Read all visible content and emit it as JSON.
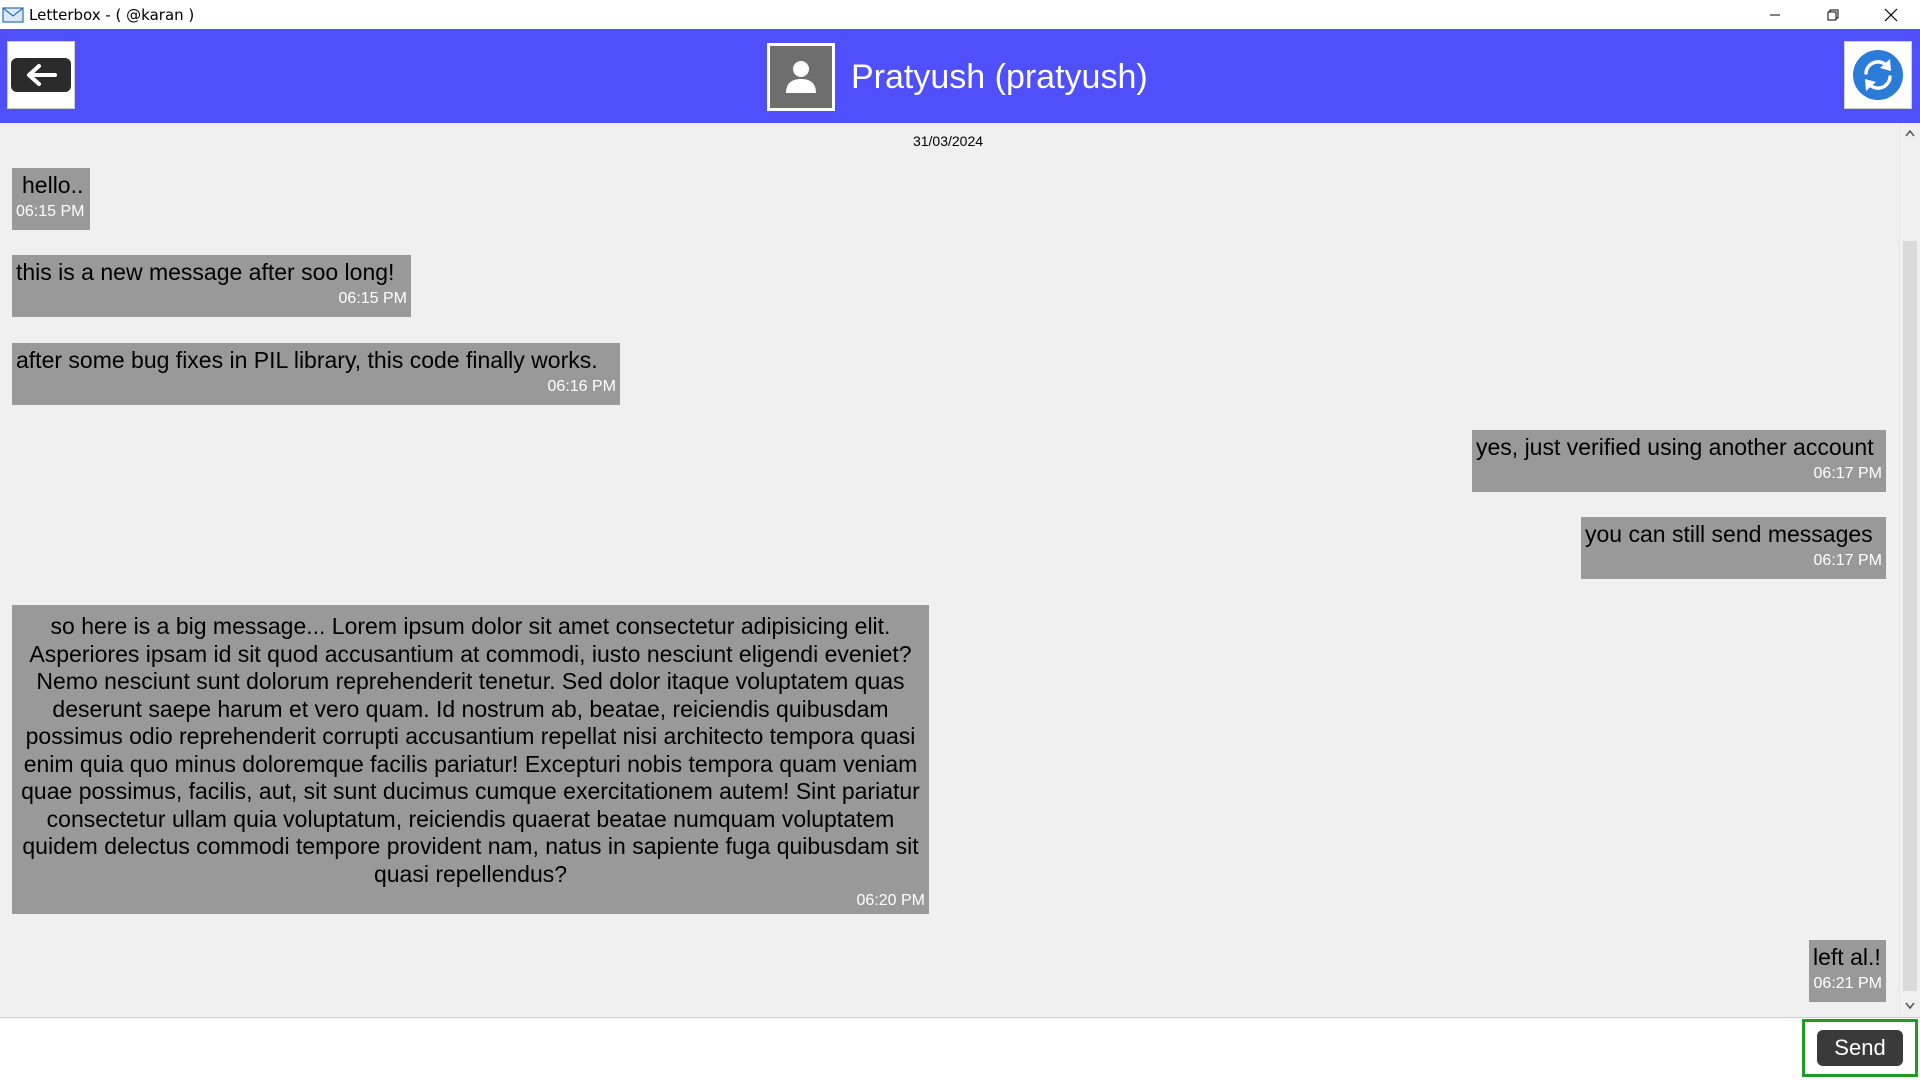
{
  "window": {
    "title": "Letterbox - ( @karan )"
  },
  "header": {
    "contact_name": "Pratyush (pratyush)",
    "accent_color": "#4f4ffc"
  },
  "chat": {
    "date": "31/03/2024",
    "messages": [
      {
        "text": "hello..",
        "time": "06:15 PM",
        "side": "left"
      },
      {
        "text": "this is a new message after soo long!",
        "time": "06:15 PM",
        "side": "left"
      },
      {
        "text": "after some bug fixes in PIL library, this code finally works.",
        "time": "06:16 PM",
        "side": "left"
      },
      {
        "text": "yes, just verified using another account",
        "time": "06:17 PM",
        "side": "right"
      },
      {
        "text": "you can still send messages",
        "time": "06:17 PM",
        "side": "right"
      },
      {
        "text": "so here is a big message...  Lorem ipsum dolor sit amet consectetur adipisicing elit. Asperiores ipsam id sit quod accusantium at commodi, iusto nesciunt eligendi eveniet? Nemo nesciunt sunt dolorum reprehenderit tenetur. Sed dolor itaque voluptatem quas deserunt saepe harum et vero quam. Id nostrum ab, beatae, reiciendis quibusdam possimus odio reprehenderit corrupti accusantium repellat nisi architecto tempora quasi enim quia quo minus doloremque facilis pariatur! Excepturi nobis tempora quam veniam quae possimus, facilis, aut, sit sunt ducimus cumque exercitationem autem! Sint pariatur consectetur ullam quia voluptatum, reiciendis quaerat beatae numquam voluptatem quidem delectus commodi tempore provident nam, natus in sapiente fuga quibusdam sit quasi repellendus?",
        "time": "06:20 PM",
        "side": "left"
      },
      {
        "text": "left al.!",
        "time": "06:21 PM",
        "side": "right"
      }
    ]
  },
  "composer": {
    "input_value": "",
    "send_label": "Send"
  },
  "icons": {
    "app": "envelope-icon",
    "back": "arrow-left-icon",
    "avatar": "user-icon",
    "refresh": "refresh-icon"
  }
}
